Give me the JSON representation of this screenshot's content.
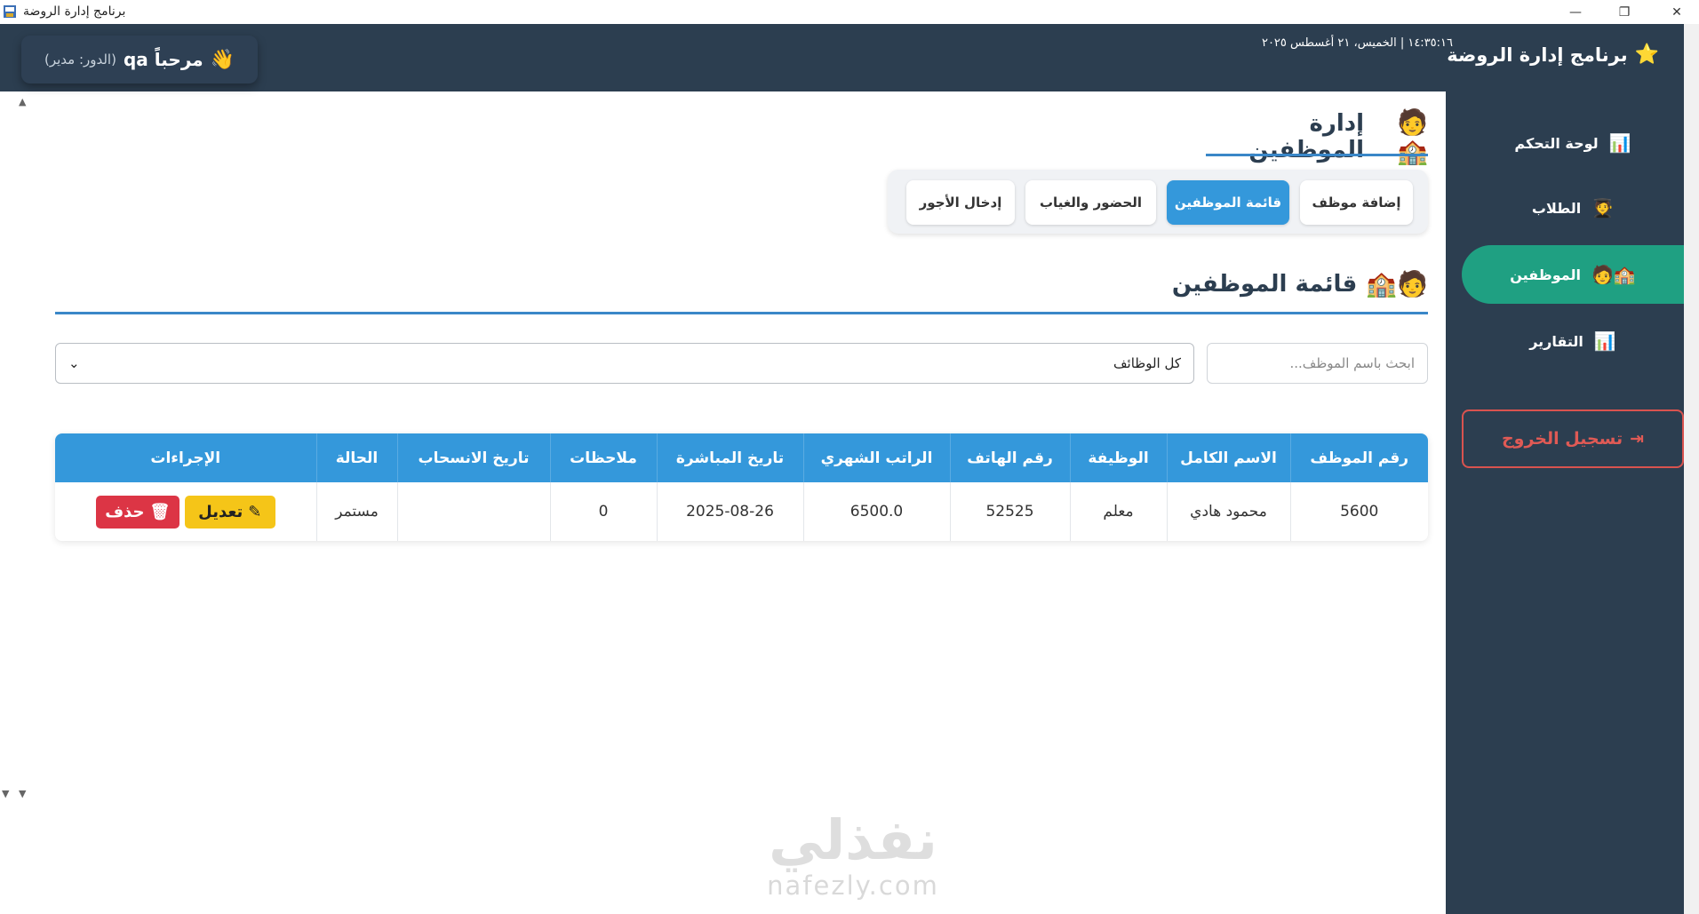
{
  "window": {
    "title": "برنامج إدارة الروضة",
    "minimize_glyph": "—",
    "maximize_glyph": "❐",
    "close_glyph": "✕"
  },
  "header": {
    "star": "⭐",
    "brand": "برنامج إدارة الروضة",
    "datetime": "١٤:٣٥:١٦  |  الخميس، ٢١ أغسطس ٢٠٢٥",
    "wave": "👋",
    "greeting": "مرحباً qa",
    "role": "(الدور: مدير)"
  },
  "sidebar": {
    "items": [
      {
        "icon": "📊",
        "label": "لوحة التحكم"
      },
      {
        "icon": "🧑‍🎓",
        "label": "الطلاب"
      },
      {
        "icon": "🏫🧑",
        "label": "الموظفين"
      },
      {
        "icon": "📊",
        "label": "التقارير"
      }
    ],
    "logout_icon": "⇥",
    "logout_label": "تسجيل الخروج"
  },
  "main": {
    "section_title": {
      "icons": "🧑🏫",
      "text": "إدارة الموظفين"
    },
    "tabs": [
      {
        "label": "إضافة موظف"
      },
      {
        "label": "قائمة الموظفين"
      },
      {
        "label": "الحضور والغياب"
      },
      {
        "label": "إدخال الأجور"
      }
    ],
    "list_title": {
      "icons": "🧑🏫",
      "text": "قائمة الموظفين"
    },
    "search": {
      "placeholder": "ابحث باسم الموظف...",
      "value": ""
    },
    "role_filter": {
      "selected": "كل الوظائف",
      "chevron": "⌄"
    },
    "table": {
      "columns": [
        "رقم الموظف",
        "الاسم الكامل",
        "الوظيفة",
        "رقم الهاتف",
        "الراتب الشهري",
        "تاريخ المباشرة",
        "ملاحظات",
        "تاريخ الانسحاب",
        "الحالة",
        "الإجراءات"
      ],
      "rows": [
        {
          "id": "5600",
          "name": "محمود هادي",
          "job": "معلم",
          "phone": "52525",
          "salary": "6500.0",
          "start_date": "2025-08-26",
          "notes": "0",
          "withdraw_date": "",
          "status": "مستمر",
          "edit_icon": "✎",
          "edit_label": "تعديل",
          "delete_icon": "🗑",
          "delete_label": "حذف"
        }
      ]
    }
  },
  "watermark": {
    "line1": "نفذلي",
    "line2": "nafezly.com"
  },
  "colors": {
    "header_bg": "#2c3e50",
    "accent_blue": "#3498db",
    "active_green": "#1fa082",
    "edit_yellow": "#f5c518",
    "delete_red": "#dc3545"
  }
}
